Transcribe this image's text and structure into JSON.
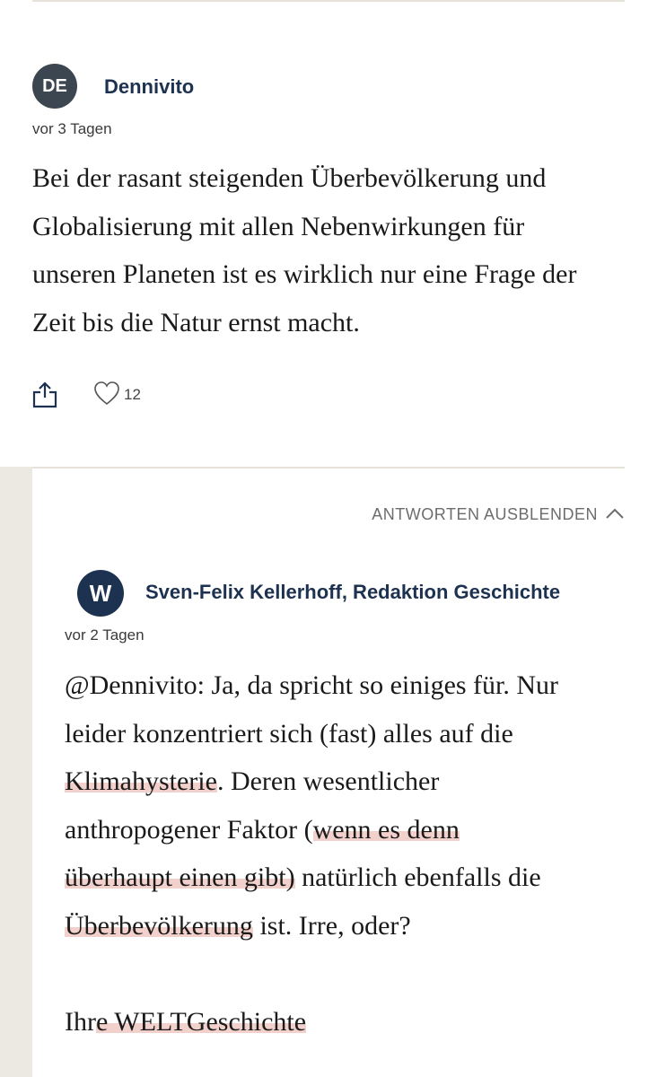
{
  "comment": {
    "avatar_initials": "DE",
    "author": "Dennivito",
    "timestamp": "vor 3 Tagen",
    "body_lines": [
      "Bei der rasant steigenden Überbevölkerung und",
      "Globalisierung mit allen Nebenwirkungen für",
      "unseren Planeten ist es wirklich nur eine Frage der",
      "Zeit bis die Natur ernst macht."
    ],
    "likes": "12",
    "icons": [
      "share-icon",
      "heart-icon"
    ]
  },
  "replies_toggle": {
    "label": "ANTWORTEN AUSBLENDEN",
    "icon": "chevron-up-icon"
  },
  "reply": {
    "avatar_initials": "W",
    "author": "Sven-Felix Kellerhoff, Redaktion Geschichte",
    "timestamp": "vor 2 Tagen",
    "line1": "@Dennivito: Ja, da spricht so einiges für. Nur",
    "line2": "leider konzentriert sich (fast) alles auf die",
    "line3_hl": "Klimahysterie",
    "line3_rest": ". Deren wesentlicher",
    "line4_pre": "anthropogener Faktor (",
    "line4_hl": "wenn es denn",
    "line5_hl": "überhaupt einen gibt)",
    "line5_rest": " natürlich ebenfalls die",
    "line6_hl": "Überbevölkerung",
    "line6_rest": " ist. Irre, oder?",
    "signoff_pre": "Ihr",
    "signoff_hl": "e WELTGeschichte"
  },
  "colors": {
    "author": "#1d3150",
    "avatar_bg": "#3c4650",
    "reply_avatar_bg": "#1d3150",
    "highlight": "#e8aaa0"
  }
}
